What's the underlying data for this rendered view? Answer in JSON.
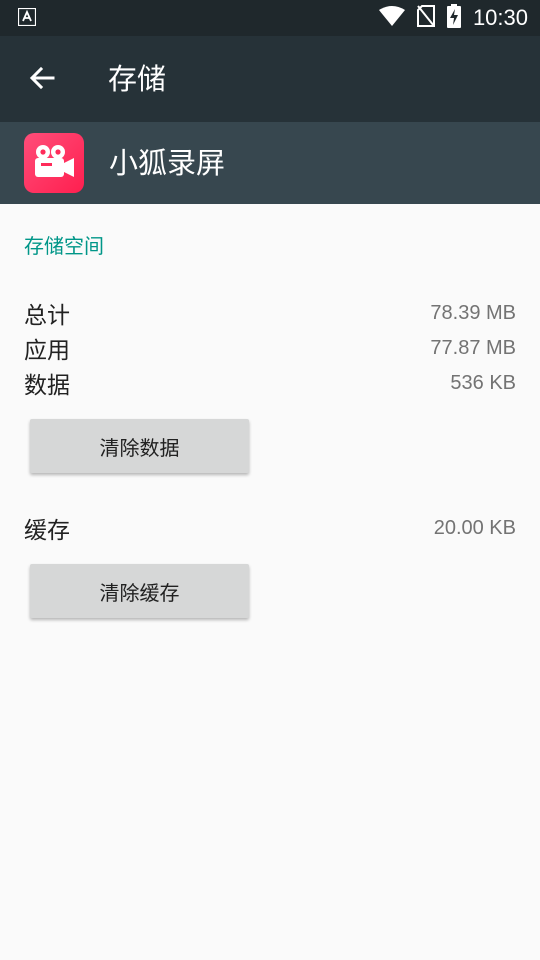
{
  "status_bar": {
    "time": "10:30",
    "icons": [
      "a-notification-icon",
      "wifi-icon",
      "no-sim-icon",
      "battery-charging-icon"
    ]
  },
  "toolbar": {
    "title": "存储",
    "back_icon": "arrow-back-icon"
  },
  "app": {
    "name": "小狐录屏",
    "icon": "video-camera-icon",
    "icon_color": "#ff2b5a"
  },
  "storage": {
    "section_title": "存储空间",
    "rows": [
      {
        "label": "总计",
        "value": "78.39 MB"
      },
      {
        "label": "应用",
        "value": "77.87 MB"
      },
      {
        "label": "数据",
        "value": "536 KB"
      }
    ],
    "clear_data_label": "清除数据",
    "cache_label": "缓存",
    "cache_value": "20.00 KB",
    "clear_cache_label": "清除缓存"
  },
  "colors": {
    "status_bar": "#1f282c",
    "toolbar": "#263238",
    "app_header": "#37474f",
    "accent": "#009688",
    "background": "#fafafa",
    "button": "#d6d7d7"
  }
}
